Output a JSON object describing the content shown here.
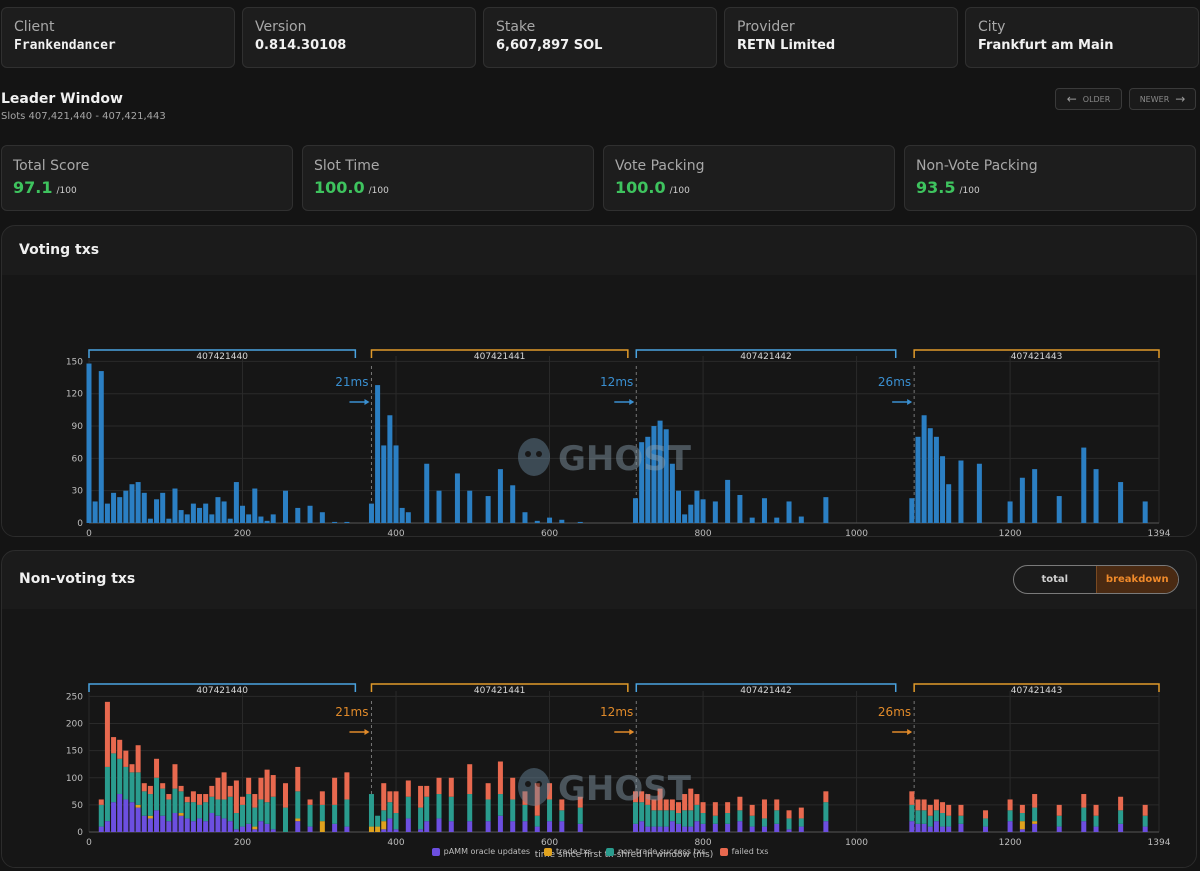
{
  "info": [
    {
      "label": "Client",
      "value": "Frankendancer",
      "mono": true
    },
    {
      "label": "Version",
      "value": "0.814.30108"
    },
    {
      "label": "Stake",
      "value": "6,607,897 SOL"
    },
    {
      "label": "Provider",
      "value": "RETN Limited"
    },
    {
      "label": "City",
      "value": "Frankfurt am Main"
    }
  ],
  "leader_window": {
    "title": "Leader Window",
    "slots": "Slots 407,421,440 - 407,421,443",
    "older_label": "OLDER",
    "newer_label": "NEWER"
  },
  "scores": [
    {
      "label": "Total Score",
      "value": "97.1",
      "max": "/100"
    },
    {
      "label": "Slot Time",
      "value": "100.0",
      "max": "/100"
    },
    {
      "label": "Vote Packing",
      "value": "100.0",
      "max": "/100"
    },
    {
      "label": "Non-Vote Packing",
      "value": "93.5",
      "max": "/100"
    }
  ],
  "voting_panel": {
    "title": "Voting txs"
  },
  "nonvoting_panel": {
    "title": "Non-voting txs",
    "toggle_total": "total",
    "toggle_breakdown": "breakdown"
  },
  "watermark": "GHOST",
  "colors": {
    "vote_bar": "#2b7fc3",
    "pamm": "#6c4fe0",
    "trade": "#e0a21e",
    "nontrade": "#2a9c8e",
    "failed": "#e8694f",
    "slot_blue": "#4aa3e0",
    "slot_orange": "#e09a2a",
    "score_green": "#3ec35e"
  },
  "chart_data": [
    {
      "type": "bar",
      "title": "Voting txs",
      "xlabel": "time since first tx-shred in window (ms)",
      "ylabel": "",
      "xlim": [
        0,
        1394
      ],
      "ylim": [
        0,
        155
      ],
      "xticks": [
        0,
        200,
        400,
        600,
        800,
        1000,
        1200,
        1394
      ],
      "yticks": [
        0,
        30,
        60,
        90,
        120,
        150
      ],
      "slots": [
        {
          "label": "407421440",
          "start": 0,
          "end": 347,
          "color": "slot_blue"
        },
        {
          "label": "407421441",
          "start": 368,
          "end": 702,
          "color": "slot_orange"
        },
        {
          "label": "407421442",
          "start": 713,
          "end": 1051,
          "color": "slot_blue"
        },
        {
          "label": "407421443",
          "start": 1075,
          "end": 1394,
          "color": "slot_orange"
        }
      ],
      "gaps": [
        {
          "label": "21ms",
          "at": 368
        },
        {
          "label": "12ms",
          "at": 713
        },
        {
          "label": "26ms",
          "at": 1075
        }
      ],
      "x": [
        0,
        8,
        16,
        24,
        32,
        40,
        48,
        56,
        64,
        72,
        80,
        88,
        96,
        104,
        112,
        120,
        128,
        136,
        144,
        152,
        160,
        168,
        176,
        184,
        192,
        200,
        208,
        216,
        224,
        232,
        240,
        256,
        272,
        288,
        304,
        320,
        336,
        368,
        376,
        384,
        392,
        400,
        408,
        416,
        440,
        456,
        480,
        496,
        520,
        536,
        552,
        568,
        584,
        600,
        616,
        640,
        712,
        720,
        728,
        736,
        744,
        752,
        760,
        768,
        776,
        784,
        792,
        800,
        816,
        832,
        848,
        864,
        880,
        896,
        912,
        928,
        960,
        1072,
        1080,
        1088,
        1096,
        1104,
        1112,
        1120,
        1136,
        1160,
        1200,
        1216,
        1232,
        1264,
        1296,
        1312,
        1344,
        1376
      ],
      "values": [
        148,
        20,
        141,
        18,
        28,
        24,
        30,
        36,
        38,
        28,
        4,
        22,
        28,
        4,
        32,
        12,
        8,
        18,
        14,
        18,
        8,
        24,
        20,
        4,
        38,
        16,
        8,
        32,
        6,
        2,
        8,
        30,
        14,
        16,
        10,
        1,
        1,
        18,
        128,
        72,
        100,
        72,
        14,
        10,
        55,
        30,
        46,
        30,
        25,
        50,
        35,
        10,
        2,
        5,
        3,
        1,
        23,
        75,
        80,
        90,
        95,
        87,
        55,
        30,
        8,
        17,
        30,
        22,
        20,
        40,
        26,
        5,
        23,
        5,
        20,
        6,
        24,
        23,
        80,
        100,
        88,
        80,
        62,
        36,
        58,
        55,
        20,
        42,
        50,
        25,
        70,
        50,
        38,
        20,
        40,
        5
      ]
    },
    {
      "type": "bar",
      "stacked": true,
      "title": "Non-voting txs",
      "xlabel": "time since first tx-shred in window (ms)",
      "ylabel": "",
      "xlim": [
        0,
        1394
      ],
      "ylim": [
        0,
        260
      ],
      "xticks": [
        0,
        200,
        400,
        600,
        800,
        1000,
        1200,
        1394
      ],
      "yticks": [
        0,
        50,
        100,
        150,
        200,
        250
      ],
      "slots": [
        {
          "label": "407421440",
          "start": 0,
          "end": 347,
          "color": "slot_blue"
        },
        {
          "label": "407421441",
          "start": 368,
          "end": 702,
          "color": "slot_orange"
        },
        {
          "label": "407421442",
          "start": 713,
          "end": 1051,
          "color": "slot_blue"
        },
        {
          "label": "407421443",
          "start": 1075,
          "end": 1394,
          "color": "slot_orange"
        }
      ],
      "gaps": [
        {
          "label": "21ms",
          "at": 368
        },
        {
          "label": "12ms",
          "at": 713
        },
        {
          "label": "26ms",
          "at": 1075
        }
      ],
      "x": [
        16,
        24,
        32,
        40,
        48,
        56,
        64,
        72,
        80,
        88,
        96,
        104,
        112,
        120,
        128,
        136,
        144,
        152,
        160,
        168,
        176,
        184,
        192,
        200,
        208,
        216,
        224,
        232,
        240,
        256,
        272,
        288,
        304,
        320,
        336,
        368,
        376,
        384,
        392,
        400,
        416,
        432,
        440,
        456,
        472,
        496,
        520,
        536,
        552,
        568,
        584,
        600,
        616,
        640,
        712,
        720,
        728,
        736,
        744,
        752,
        760,
        768,
        776,
        784,
        792,
        800,
        816,
        832,
        848,
        864,
        880,
        896,
        912,
        928,
        960,
        1072,
        1080,
        1088,
        1096,
        1104,
        1112,
        1120,
        1136,
        1168,
        1200,
        1216,
        1232,
        1264,
        1296,
        1312,
        1344,
        1376
      ],
      "series": [
        {
          "name": "pAMM oracle updates",
          "color": "pamm",
          "values": [
            10,
            20,
            55,
            70,
            60,
            55,
            45,
            30,
            25,
            40,
            30,
            20,
            35,
            30,
            25,
            20,
            25,
            20,
            35,
            30,
            25,
            20,
            5,
            10,
            15,
            5,
            20,
            15,
            5,
            0,
            20,
            10,
            0,
            15,
            10,
            0,
            0,
            5,
            25,
            5,
            25,
            5,
            20,
            25,
            20,
            20,
            20,
            30,
            20,
            20,
            10,
            20,
            20,
            15,
            15,
            20,
            10,
            10,
            10,
            10,
            20,
            15,
            10,
            10,
            20,
            15,
            15,
            15,
            20,
            10,
            10,
            15,
            5,
            10,
            20,
            20,
            15,
            15,
            10,
            20,
            10,
            10,
            15,
            10,
            20,
            5,
            15,
            10,
            20,
            10,
            15,
            10
          ]
        },
        {
          "name": "trade txs",
          "color": "trade",
          "values": [
            0,
            0,
            0,
            0,
            0,
            0,
            5,
            0,
            5,
            0,
            0,
            0,
            0,
            5,
            0,
            0,
            0,
            0,
            0,
            0,
            0,
            0,
            0,
            0,
            0,
            5,
            0,
            0,
            0,
            0,
            5,
            0,
            20,
            0,
            0,
            10,
            10,
            15,
            0,
            0,
            0,
            0,
            0,
            0,
            0,
            0,
            0,
            0,
            0,
            0,
            0,
            0,
            0,
            0,
            0,
            0,
            0,
            0,
            0,
            0,
            0,
            0,
            0,
            0,
            0,
            0,
            0,
            0,
            0,
            0,
            0,
            0,
            0,
            0,
            0,
            0,
            0,
            0,
            0,
            0,
            0,
            0,
            0,
            0,
            0,
            15,
            5,
            0,
            0,
            0,
            0,
            0
          ]
        },
        {
          "name": "non-trade success txs",
          "color": "nontrade",
          "values": [
            40,
            100,
            90,
            65,
            60,
            55,
            60,
            45,
            40,
            60,
            50,
            40,
            45,
            40,
            30,
            35,
            25,
            35,
            30,
            30,
            35,
            45,
            30,
            40,
            55,
            35,
            40,
            40,
            60,
            45,
            50,
            40,
            30,
            35,
            50,
            60,
            20,
            20,
            30,
            30,
            40,
            40,
            45,
            45,
            45,
            50,
            40,
            40,
            40,
            30,
            20,
            40,
            20,
            30,
            40,
            35,
            40,
            30,
            30,
            30,
            20,
            20,
            30,
            30,
            30,
            20,
            15,
            20,
            20,
            20,
            15,
            25,
            20,
            15,
            35,
            30,
            25,
            25,
            20,
            20,
            25,
            20,
            15,
            15,
            20,
            15,
            25,
            20,
            25,
            20,
            25,
            20
          ]
        },
        {
          "name": "failed txs",
          "color": "failed",
          "values": [
            10,
            120,
            30,
            35,
            30,
            15,
            50,
            15,
            15,
            35,
            10,
            10,
            45,
            10,
            10,
            20,
            20,
            15,
            20,
            40,
            50,
            20,
            60,
            15,
            30,
            25,
            40,
            60,
            40,
            45,
            45,
            10,
            25,
            50,
            50,
            0,
            0,
            50,
            20,
            40,
            30,
            40,
            20,
            30,
            35,
            55,
            30,
            60,
            40,
            25,
            60,
            30,
            20,
            20,
            20,
            20,
            20,
            20,
            40,
            20,
            20,
            20,
            30,
            40,
            20,
            20,
            25,
            20,
            25,
            20,
            35,
            20,
            15,
            20,
            20,
            25,
            20,
            20,
            20,
            20,
            20,
            20,
            20,
            15,
            20,
            15,
            25,
            20,
            25,
            20,
            25,
            20
          ]
        }
      ]
    }
  ]
}
